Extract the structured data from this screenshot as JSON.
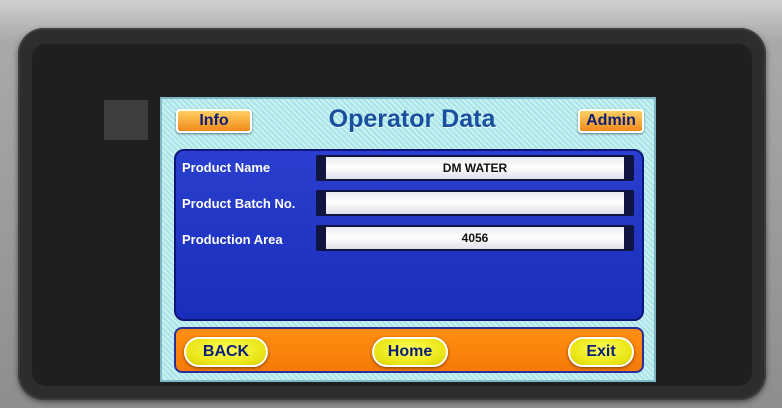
{
  "screen": {
    "title": "Operator Data",
    "info_button": "Info",
    "admin_button": "Admin"
  },
  "fields": [
    {
      "label": "Product Name",
      "value": "DM WATER"
    },
    {
      "label": "Product Batch No.",
      "value": ""
    },
    {
      "label": "Production Area",
      "value": "4056"
    }
  ],
  "nav": {
    "back_label": "BACK",
    "home_label": "Home",
    "exit_label": "Exit"
  },
  "colors": {
    "screen_bg": "#b6ecee",
    "panel": "#2236c7",
    "nav_bar": "#f7820c",
    "button_orange": "#f59a2a",
    "button_yellow": "#f2ee1e",
    "title_text": "#1a4e9f"
  }
}
